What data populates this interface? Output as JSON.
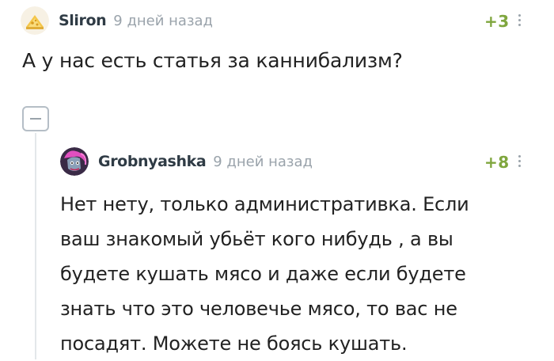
{
  "comments": [
    {
      "author": "Sliron",
      "time": "9 дней назад",
      "rating": "+3",
      "text": "А у нас есть статья за каннибализм?"
    },
    {
      "author": "Grobnyashka",
      "time": "9 дней назад",
      "rating": "+8",
      "lines": [
        "Нет нету, только административка. Если",
        "ваш знакомый убьёт кого нибудь , а вы",
        "будете кушать мясо и даже если будете",
        "знать что это человечье мясо, то вас не",
        "посадят. Можете не боясь кушать."
      ]
    }
  ],
  "colors": {
    "rating": "#7fa63e",
    "meta": "#9aa3ab",
    "author": "#2f3b45",
    "text": "#222222"
  },
  "icons": [
    "avatar-sliron",
    "avatar-grobnyashka",
    "more-vertical-icon",
    "collapse-minus-icon"
  ]
}
